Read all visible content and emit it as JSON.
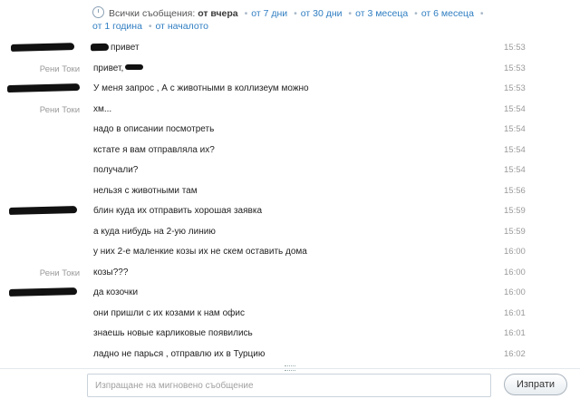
{
  "filter": {
    "label": "Всички съобщения:",
    "active": "от вчера",
    "options": [
      "от 7 дни",
      "от 30 дни",
      "от 3 месеца",
      "от 6 месеца",
      "от 1 година",
      "от началото"
    ]
  },
  "messages": [
    {
      "author": "",
      "text": "привет",
      "time": "15:53"
    },
    {
      "author": "Рени Токи",
      "text": "привет,",
      "time": "15:53"
    },
    {
      "author": "",
      "text": "У меня запрос , А с животными в коллизеум можно",
      "time": "15:53"
    },
    {
      "author": "Рени Токи",
      "text": "хм...",
      "time": "15:54"
    },
    {
      "author": "",
      "text": "надо в описании посмотреть",
      "time": "15:54"
    },
    {
      "author": "",
      "text": "кстате я вам отправляла их?",
      "time": "15:54"
    },
    {
      "author": "",
      "text": "получали?",
      "time": "15:54"
    },
    {
      "author": "",
      "text": "нельзя с животными там",
      "time": "15:56"
    },
    {
      "author": "",
      "text": "блин куда их отправить хорошая заявка",
      "time": "15:59"
    },
    {
      "author": "",
      "text": "а куда нибудь на 2-ую линию",
      "time": "15:59"
    },
    {
      "author": "",
      "text": "у них 2-е маленкие козы их не скем оставить дома",
      "time": "16:00"
    },
    {
      "author": "Рени Токи",
      "text": "козы???",
      "time": "16:00"
    },
    {
      "author": "",
      "text": "да козочки",
      "time": "16:00"
    },
    {
      "author": "",
      "text": "они пришли с их  козами к нам офис",
      "time": "16:01"
    },
    {
      "author": "",
      "text": "знаешь новые карликовые появились",
      "time": "16:01"
    },
    {
      "author": "",
      "text": "ладно не парься , отправлю их в Турцию",
      "time": "16:02"
    }
  ],
  "composer": {
    "placeholder": "Изпращане на мигновено съобщение",
    "value": "",
    "send_label": "Изпрати"
  }
}
